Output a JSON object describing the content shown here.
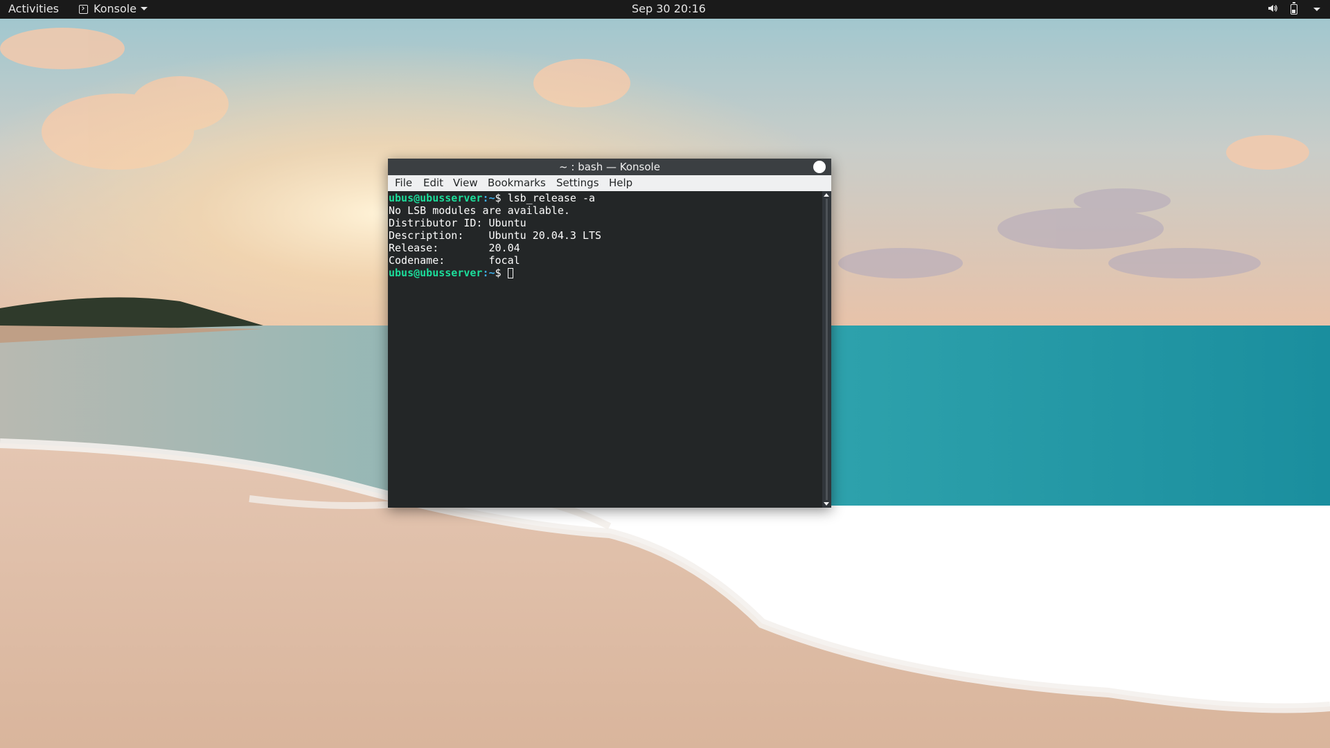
{
  "topbar": {
    "activities_label": "Activities",
    "app_name": "Konsole",
    "clock": "Sep 30  20:16",
    "icons": [
      "terminal-icon",
      "volume-icon",
      "battery-icon",
      "system-menu-icon"
    ]
  },
  "window": {
    "title": "~ : bash — Konsole",
    "menus": [
      "File",
      "Edit",
      "View",
      "Bookmarks",
      "Settings",
      "Help"
    ]
  },
  "terminal": {
    "prompt_user": "ubus@ubusserver",
    "prompt_path": ":~",
    "prompt_symbol": "$ ",
    "command": "lsb_release -a",
    "output": [
      "No LSB modules are available.",
      "Distributor ID: Ubuntu",
      "Description:    Ubuntu 20.04.3 LTS",
      "Release:        20.04",
      "Codename:       focal"
    ]
  },
  "colors": {
    "prompt_user": "#1cdc9a",
    "prompt_path": "#3daee9",
    "terminal_bg": "#232627",
    "terminal_fg": "#fcfcfc",
    "topbar_bg": "#1a1a1a"
  }
}
